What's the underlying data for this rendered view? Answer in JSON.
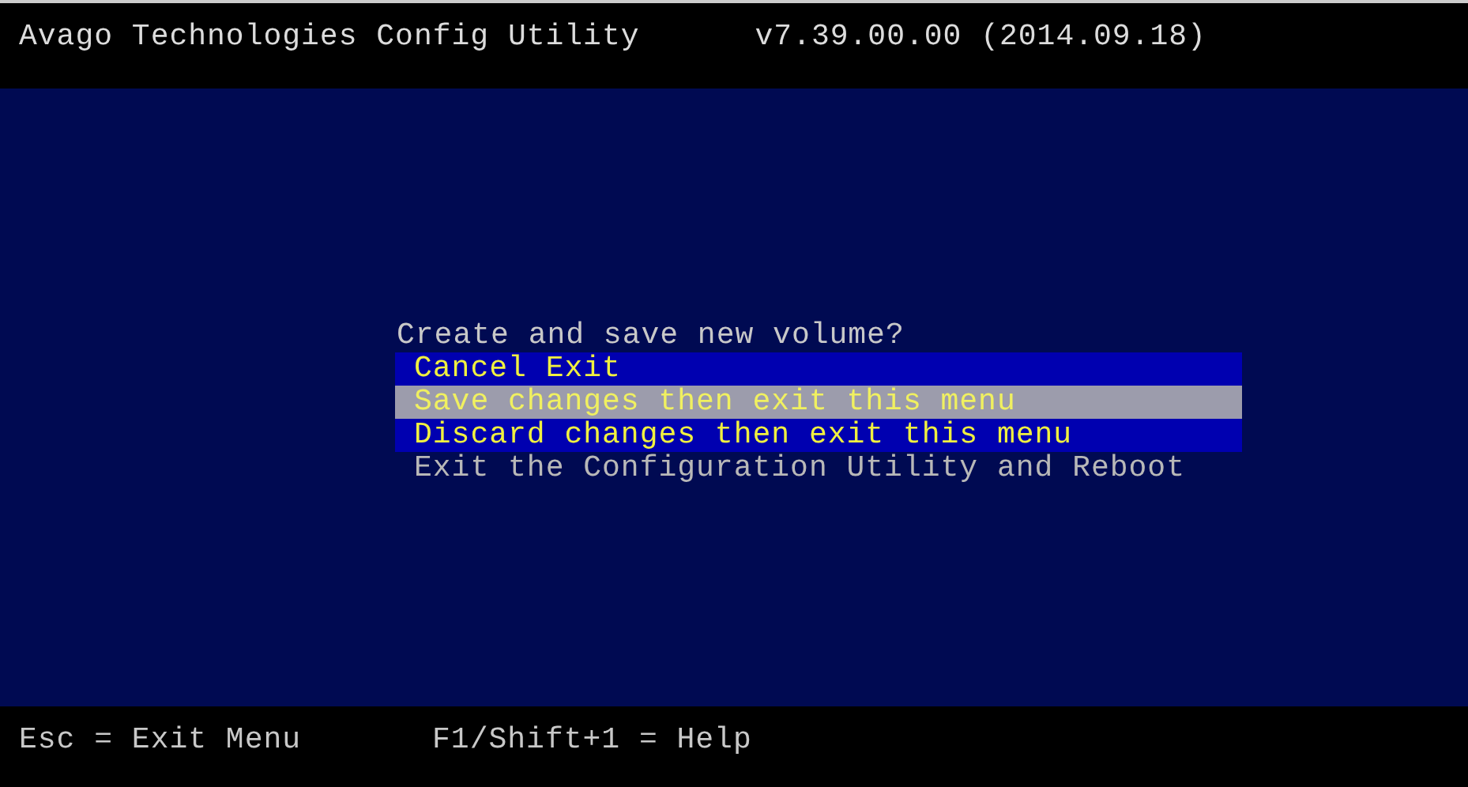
{
  "header": {
    "title": "Avago Technologies Config Utility",
    "version": "v7.39.00.00 (2014.09.18)"
  },
  "dialog": {
    "prompt": "Create and save new volume?",
    "items": [
      {
        "label": "Cancel Exit",
        "selected": false,
        "disabled": false
      },
      {
        "label": "Save changes then exit this menu",
        "selected": true,
        "disabled": false
      },
      {
        "label": "Discard changes then exit this menu",
        "selected": false,
        "disabled": false
      },
      {
        "label": "Exit the Configuration Utility and Reboot",
        "selected": false,
        "disabled": true
      }
    ]
  },
  "footer": {
    "hints": [
      "Esc = Exit Menu",
      "F1/Shift+1 = Help"
    ]
  }
}
